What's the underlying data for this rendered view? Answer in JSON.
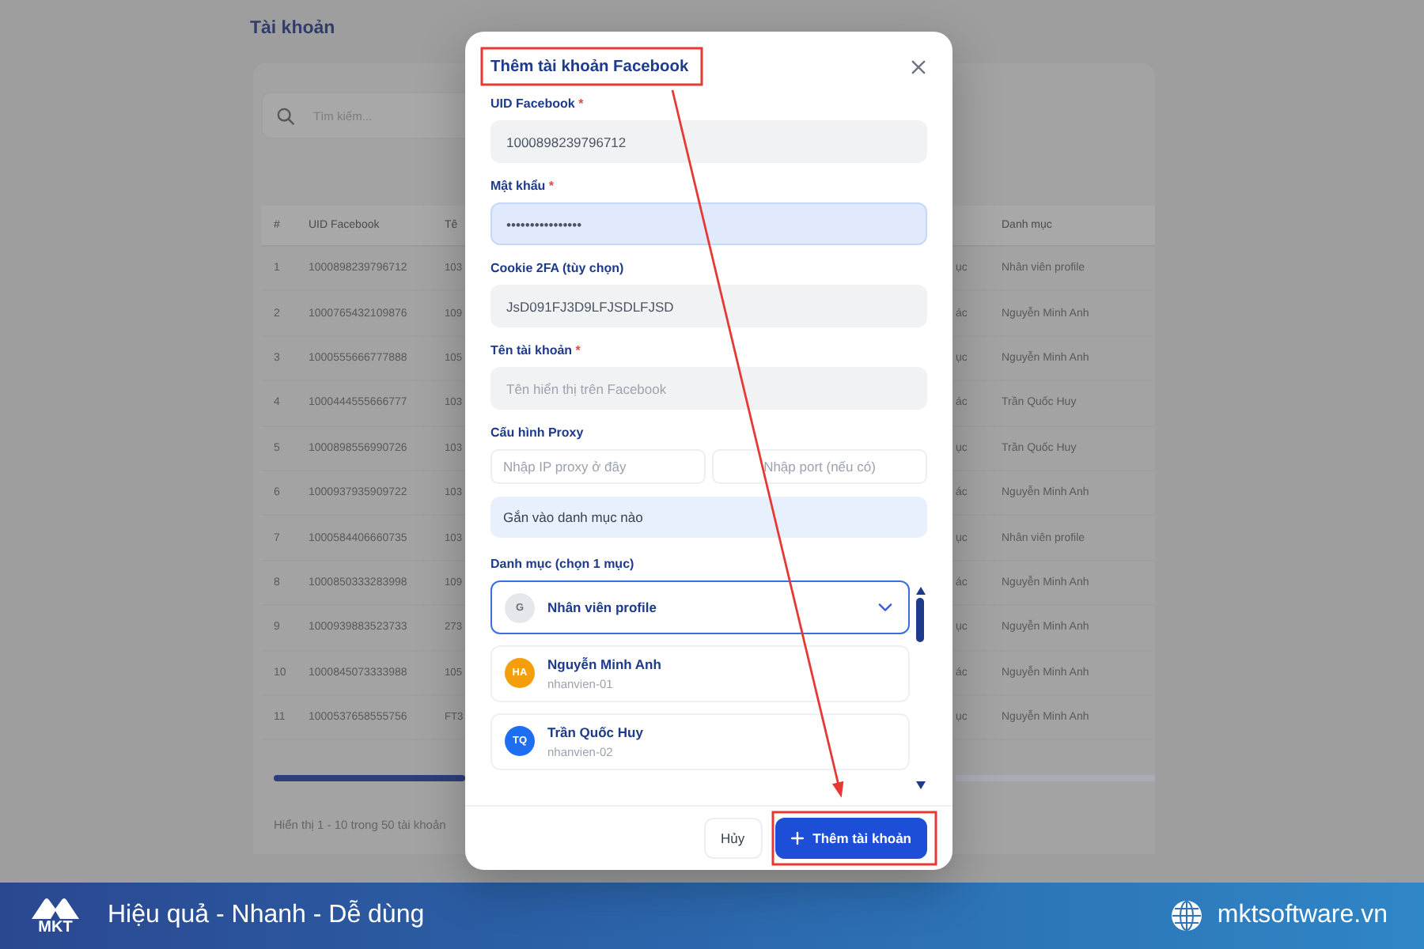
{
  "page": {
    "title": "Tài khoản",
    "search": {
      "placeholder": "Tìm kiếm..."
    },
    "table": {
      "columns": {
        "index": "#",
        "uid": "UID Facebook",
        "column_3": "Tê",
        "category": "Danh mục"
      },
      "rows": [
        {
          "index": "1",
          "uid": "1000898239796712",
          "column_3": "103",
          "column_4": "ục",
          "category": "Nhân viên profile"
        },
        {
          "index": "2",
          "uid": "1000765432109876",
          "column_3": "109",
          "column_4": "ác",
          "category": "Nguyễn Minh Anh"
        },
        {
          "index": "3",
          "uid": "1000555666777888",
          "column_3": "105",
          "column_4": "ục",
          "category": "Nguyễn Minh Anh"
        },
        {
          "index": "4",
          "uid": "1000444555666777",
          "column_3": "103",
          "column_4": "ác",
          "category": "Trần Quốc Huy"
        },
        {
          "index": "5",
          "uid": "1000898556990726",
          "column_3": "103",
          "column_4": "ục",
          "category": "Trần Quốc Huy"
        },
        {
          "index": "6",
          "uid": "1000937935909722",
          "column_3": "103",
          "column_4": "ác",
          "category": "Nguyễn Minh Anh"
        },
        {
          "index": "7",
          "uid": "1000584406660735",
          "column_3": "103",
          "column_4": "ục",
          "category": "Nhân viên profile"
        },
        {
          "index": "8",
          "uid": "1000850333283998",
          "column_3": "109",
          "column_4": "ác",
          "category": "Nguyễn Minh Anh"
        },
        {
          "index": "9",
          "uid": "1000939883523733",
          "column_3": "273",
          "column_4": "ục",
          "category": "Nguyễn Minh Anh"
        },
        {
          "index": "10",
          "uid": "1000845073333988",
          "column_3": "105",
          "column_4": "ác",
          "category": "Nguyễn Minh Anh"
        },
        {
          "index": "11",
          "uid": "1000537658555756",
          "column_3": "FT3",
          "column_4": "ục",
          "category": "Nguyễn Minh Anh"
        }
      ]
    },
    "status": "Hiển thị 1 - 10 trong 50 tài khoản"
  },
  "dialog": {
    "title": "Thêm tài khoản Facebook",
    "fields": [
      {
        "label": "UID Facebook",
        "mark": "*",
        "value": "1000898239796712",
        "focused": false
      },
      {
        "label": "Mật khẩu",
        "mark": "*",
        "value": "••••••••••••••••",
        "focused": true
      },
      {
        "label": "Cookie 2FA (tùy chọn)",
        "value": "JsD091FJ3D9LFJSDLFJSD",
        "focused": false
      },
      {
        "label": "Tên tài khoản",
        "mark": "*",
        "placeholder": "Tên hiển thị trên Facebook",
        "focused": false
      }
    ],
    "proxy": {
      "label": "Cấu hình Proxy",
      "ip_placeholder": "Nhập IP proxy ở đây",
      "port_placeholder": "Nhập port (nếu có)"
    },
    "section_banner": "Gắn vào danh mục nào",
    "category_label": "Danh mục (chọn 1 mục)",
    "categories": [
      {
        "initials": "G",
        "name": "Nhân viên profile",
        "selected": true,
        "color": "#e5e7eb"
      },
      {
        "initials": "HA",
        "name": "Nguyễn Minh Anh",
        "subtitle": "nhanvien-01",
        "selected": false,
        "color": "#f59e0b"
      },
      {
        "initials": "TQ",
        "name": "Trần Quốc Huy",
        "subtitle": "nhanvien-02",
        "selected": false,
        "color": "#1d6ef0"
      }
    ],
    "buttons": [
      {
        "label": "Hủy",
        "kind": "secondary"
      },
      {
        "label": "Thêm tài khoản",
        "kind": "primary"
      }
    ]
  },
  "banner": {
    "logo_text": "MKT",
    "slogan": "Hiệu quả - Nhanh - Dễ dùng",
    "website": "mktsoftware.vn"
  }
}
